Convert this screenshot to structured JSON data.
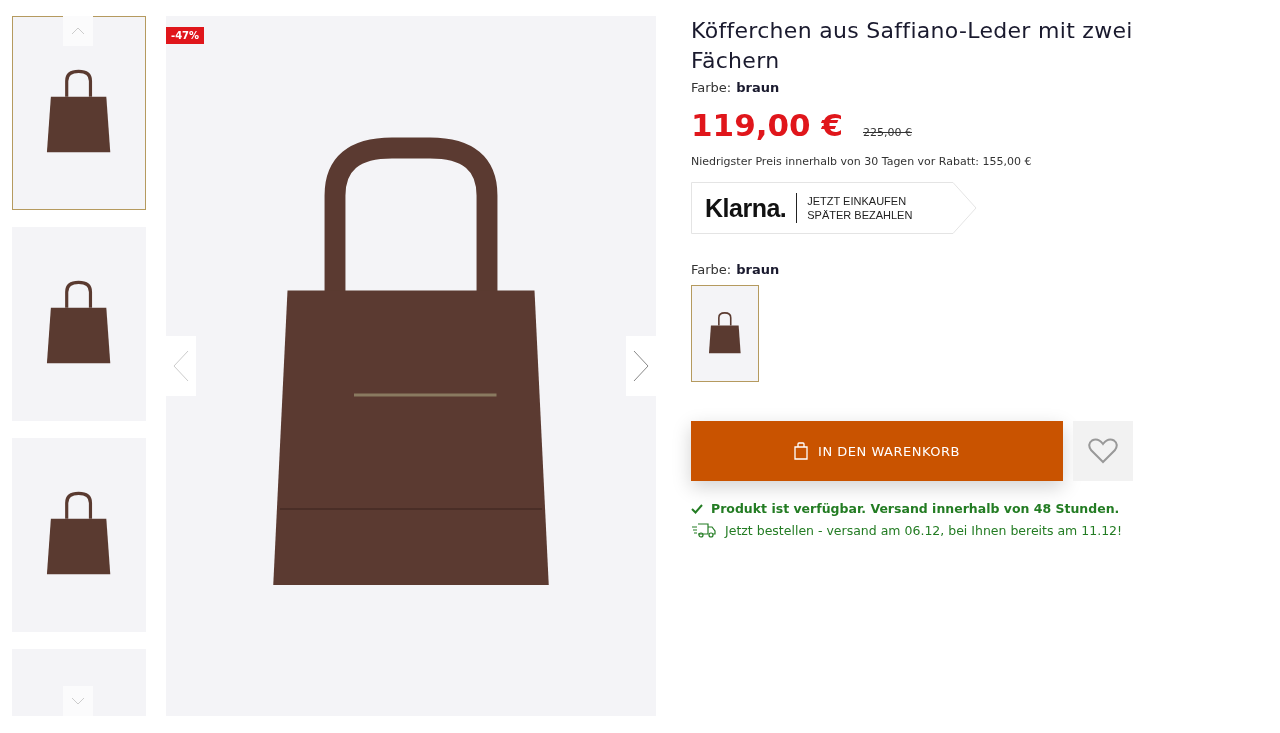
{
  "thumbnails": [
    {
      "selected": true
    },
    {
      "selected": false
    },
    {
      "selected": false
    },
    {
      "selected": false
    }
  ],
  "gallery": {
    "badge": "-47%"
  },
  "product": {
    "title": "Köfferchen aus Saffiano-Leder mit zwei Fächern",
    "color_label": "Farbe:",
    "color_value": "braun",
    "price": "119,00 €",
    "old_price": "225,00 €",
    "lowest_price_note": "Niedrigster Preis innerhalb von 30 Tagen vor Rabatt: 155,00 €"
  },
  "klarna": {
    "logo": "Klarna.",
    "line_1": "JETZT EINKAUFEN",
    "line_2": "SPÄTER BEZAHLEN"
  },
  "color_picker": {
    "label": "Farbe:",
    "value": "braun",
    "swatches": [
      {
        "selected": true
      }
    ]
  },
  "cart_button": "IN DEN WARENKORB",
  "availability": "Produkt ist verfügbar. Versand innerhalb von 48 Stunden.",
  "shipping": "Jetzt bestellen - versand am 06.12, bei Ihnen bereits am 11.12!"
}
